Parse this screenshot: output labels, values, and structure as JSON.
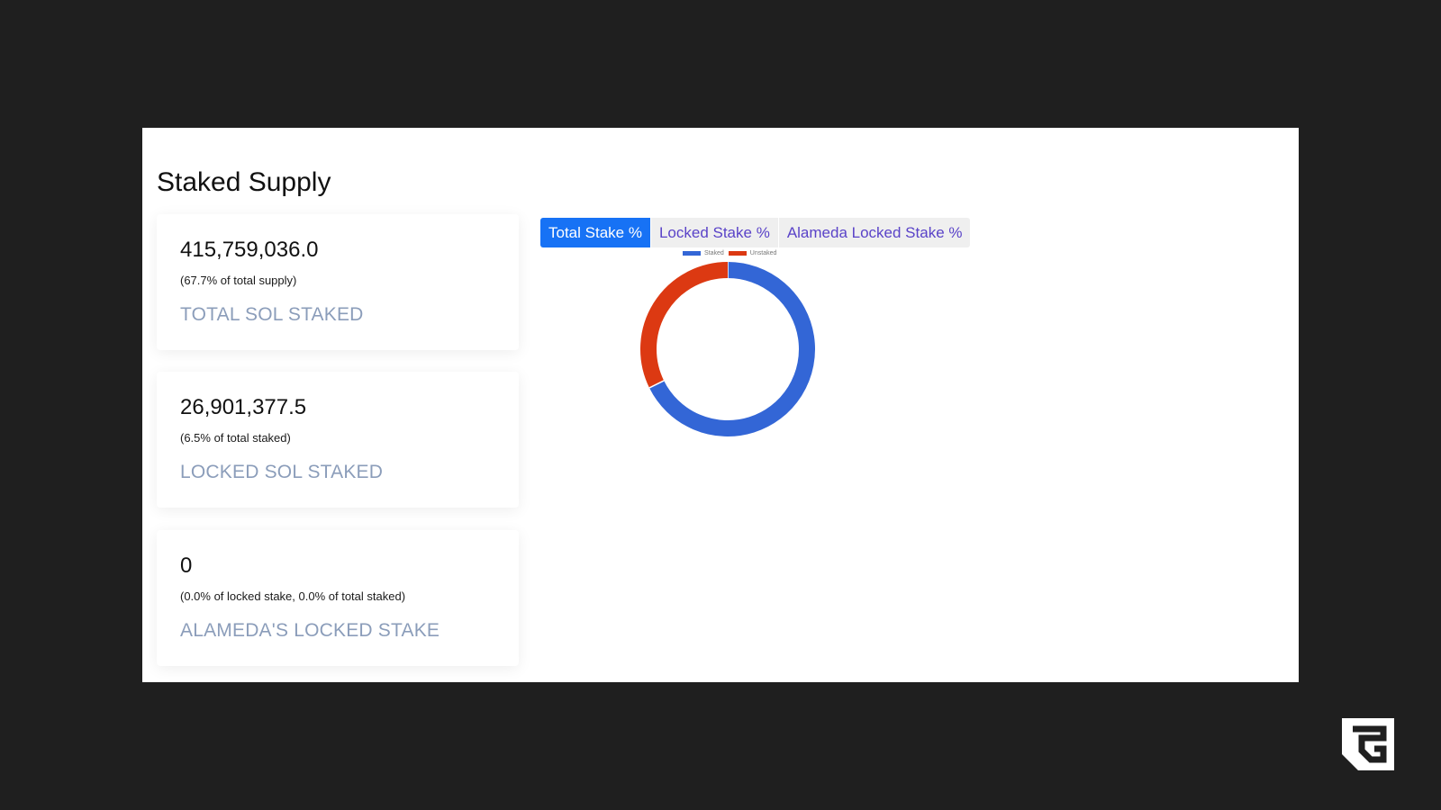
{
  "page": {
    "title": "Staked Supply"
  },
  "cards": [
    {
      "value": "415,759,036.0",
      "note": "(67.7% of total supply)",
      "label": "TOTAL SOL STAKED"
    },
    {
      "value": "26,901,377.5",
      "note": "(6.5% of total staked)",
      "label": "LOCKED SOL STAKED"
    },
    {
      "value": "0",
      "note": "(0.0% of locked stake, 0.0% of total staked)",
      "label": "ALAMEDA'S LOCKED STAKE"
    }
  ],
  "tabs": [
    {
      "label": "Total Stake %",
      "active": true
    },
    {
      "label": "Locked Stake %",
      "active": false
    },
    {
      "label": "Alameda Locked Stake %",
      "active": false
    }
  ],
  "chart_data": {
    "type": "pie",
    "categories": [
      "Staked",
      "Unstaked"
    ],
    "values": [
      67.7,
      32.3
    ],
    "colors": [
      "#3366d6",
      "#dc3912"
    ],
    "legend_position": "top",
    "donut": true
  },
  "colors": {
    "background": "#1f1f1f",
    "panel": "#ffffff",
    "accent": "#1772f5",
    "tab_text": "#5a43c8",
    "card_label": "#8b9dba"
  },
  "logo": {
    "icon": "corner-brand-logo-icon"
  }
}
